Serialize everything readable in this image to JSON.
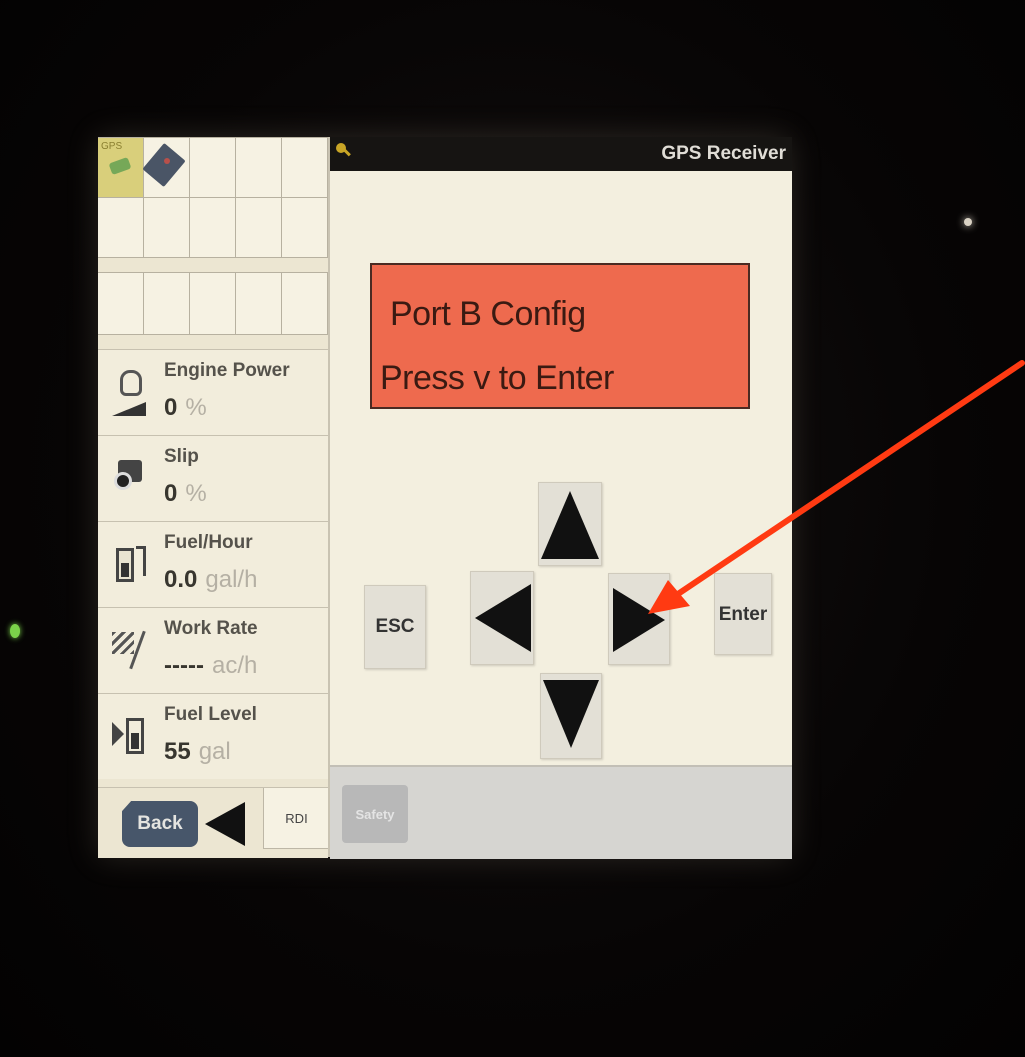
{
  "title_bar": {
    "title": "GPS Receiver"
  },
  "grid": {
    "gps_badge": "GPS"
  },
  "display": {
    "line1": "Port B Config",
    "line2": "Press v to Enter"
  },
  "keys": {
    "esc": "ESC",
    "enter": "Enter"
  },
  "readouts": [
    {
      "label": "Engine Power",
      "value": "0",
      "unit": "%",
      "icon": "engine-icon"
    },
    {
      "label": "Slip",
      "value": "0",
      "unit": "%",
      "icon": "tractor-slip-icon"
    },
    {
      "label": "Fuel/Hour",
      "value": "0.0",
      "unit": "gal/h",
      "icon": "fuel-pump-icon"
    },
    {
      "label": "Work Rate",
      "value": "-----",
      "unit": "ac/h",
      "icon": "work-rate-icon"
    },
    {
      "label": "Fuel Level",
      "value": "55",
      "unit": "gal",
      "icon": "fuel-level-icon"
    }
  ],
  "bottom": {
    "back": "Back",
    "rdi_tab": "RDI",
    "safety_tab": "Safety"
  },
  "colors": {
    "display_bg": "#ee6a4e",
    "annotation_arrow": "#ff3a12",
    "back_button": "#47566a"
  }
}
